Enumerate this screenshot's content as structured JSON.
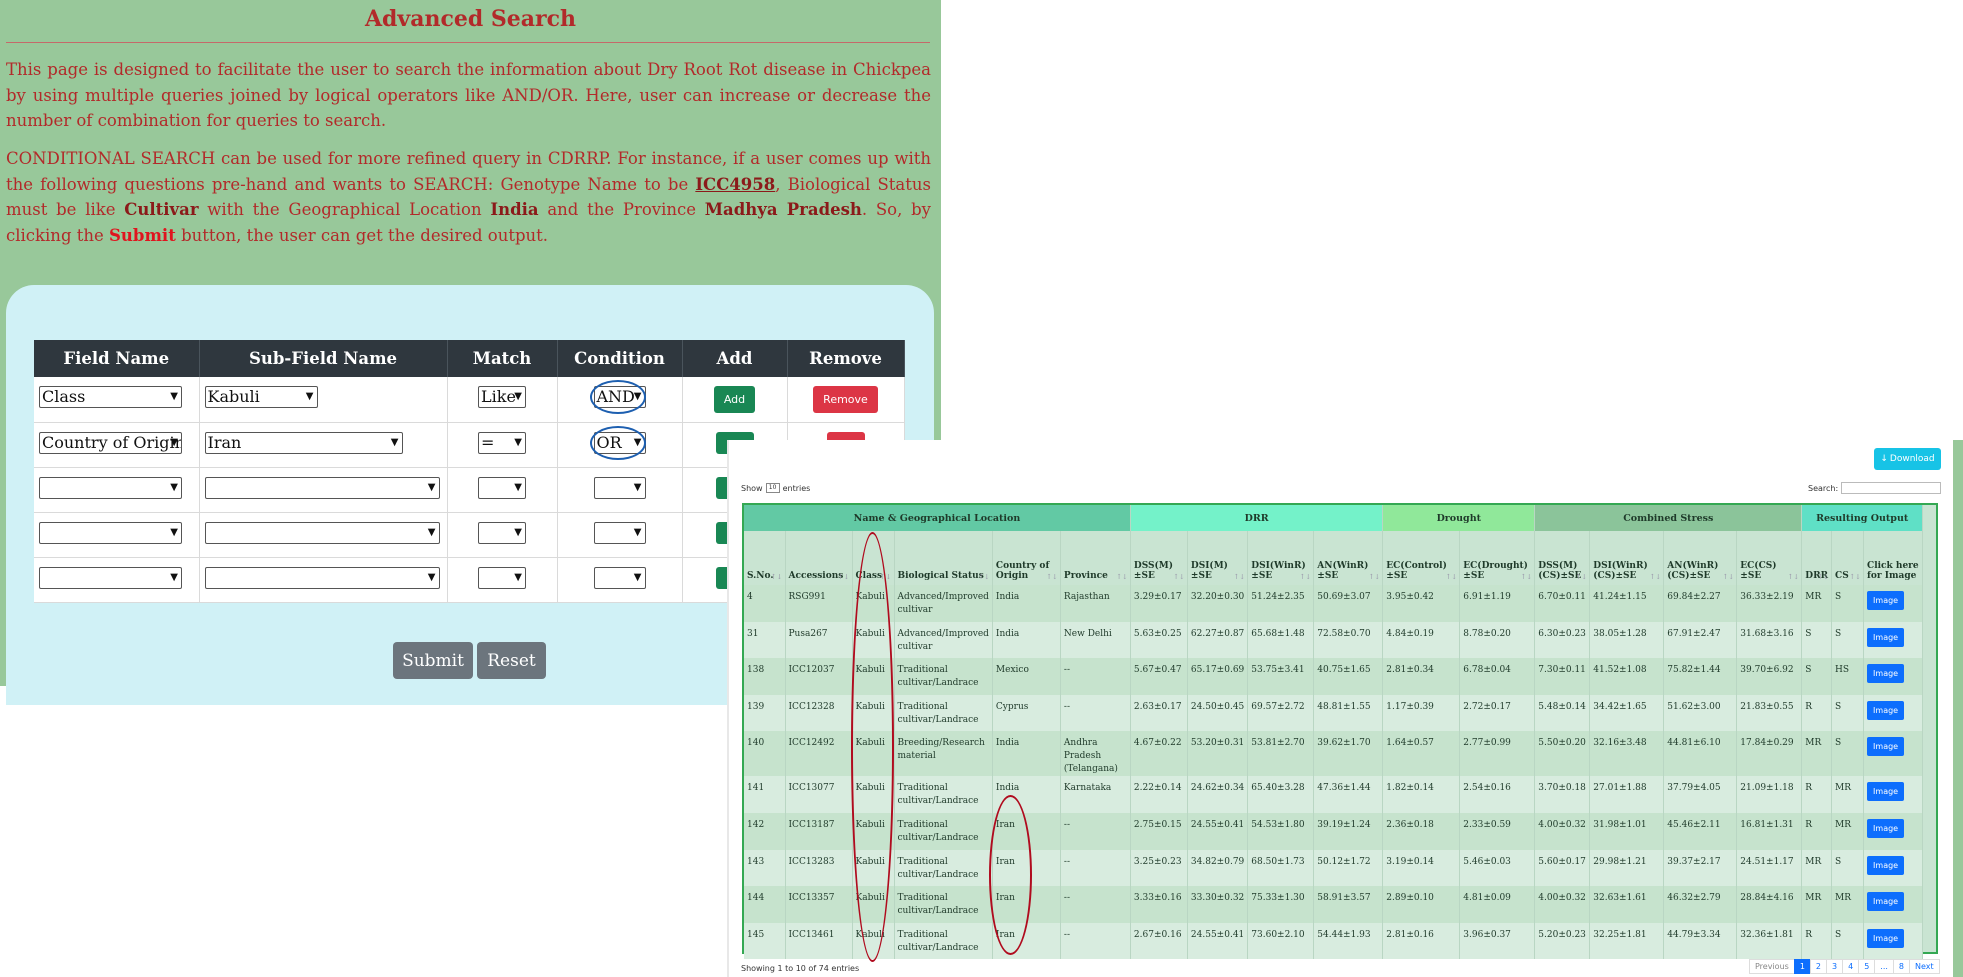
{
  "title": "Advanced Search",
  "intro1": "This page is designed to facilitate the user to search the information about Dry Root Rot disease in Chickpea by using multiple queries joined by logical operators like AND/OR. Here, user can increase or decrease the number of combination for queries to search.",
  "intro2": {
    "p1": "CONDITIONAL SEARCH can be used for more refined query in CDRRP. For instance, if a user comes up with the following questions pre-hand and wants to SEARCH: Genotype Name to be ",
    "b1": "ICC4958",
    "p2": ", Biological Status must be like ",
    "b2": "Cultivar",
    "p3": " with the Geographical Location ",
    "b3": "India",
    "p4": " and the Province ",
    "b4": "Madhya Pradesh",
    "p5": ". So, by clicking the ",
    "b5": "Submit",
    "p6": " button, the user can get the desired output."
  },
  "query_table": {
    "headers": [
      "Field Name",
      "Sub-Field Name",
      "Match",
      "Condition",
      "Add",
      "Remove"
    ],
    "rows": [
      {
        "field": "Class",
        "subfield": "Kabuli",
        "match": "Like",
        "condition": "AND"
      },
      {
        "field": "Country of Origin",
        "subfield": "Iran",
        "match": "=",
        "condition": "OR"
      },
      {
        "field": "",
        "subfield": "",
        "match": "",
        "condition": ""
      },
      {
        "field": "",
        "subfield": "",
        "match": "",
        "condition": ""
      },
      {
        "field": "",
        "subfield": "",
        "match": "",
        "condition": ""
      }
    ],
    "add_label": "Add",
    "remove_label": "Remove"
  },
  "submit_label": "Submit",
  "reset_label": "Reset",
  "results": {
    "download_label": "Download",
    "show_label": "Show",
    "show_value": "10",
    "entries_label": "entries",
    "search_label": "Search:",
    "groups": [
      {
        "label": "Name & Geographical Location"
      },
      {
        "label": "DRR"
      },
      {
        "label": "Drought"
      },
      {
        "label": "Combined Stress"
      },
      {
        "label": "Resulting Output"
      }
    ],
    "columns": [
      "S.No.",
      "Accessions",
      "Class",
      "Biological Status",
      "Country of Origin",
      "Province",
      "DSS(M) ±SE",
      "DSI(M) ±SE",
      "DSI(WinR) ±SE",
      "AN(WinR) ±SE",
      "EC(Control) ±SE",
      "EC(Drought) ±SE",
      "DSS(M) (CS)±SE",
      "DSI(WinR) (CS)±SE",
      "AN(WinR) (CS)±SE",
      "EC(CS) ±SE",
      "DRR",
      "CS",
      "Click here for Image"
    ],
    "rows": [
      [
        "4",
        "RSG991",
        "Kabuli",
        "Advanced/Improved cultivar",
        "India",
        "Rajasthan",
        "3.29±0.17",
        "32.20±0.30",
        "51.24±2.35",
        "50.69±3.07",
        "3.95±0.42",
        "6.91±1.19",
        "6.70±0.11",
        "41.24±1.15",
        "69.84±2.27",
        "36.33±2.19",
        "MR",
        "S"
      ],
      [
        "31",
        "Pusa267",
        "Kabuli",
        "Advanced/Improved cultivar",
        "India",
        "New Delhi",
        "5.63±0.25",
        "62.27±0.87",
        "65.68±1.48",
        "72.58±0.70",
        "4.84±0.19",
        "8.78±0.20",
        "6.30±0.23",
        "38.05±1.28",
        "67.91±2.47",
        "31.68±3.16",
        "S",
        "S"
      ],
      [
        "138",
        "ICC12037",
        "Kabuli",
        "Traditional cultivar/Landrace",
        "Mexico",
        "--",
        "5.67±0.47",
        "65.17±0.69",
        "53.75±3.41",
        "40.75±1.65",
        "2.81±0.34",
        "6.78±0.04",
        "7.30±0.11",
        "41.52±1.08",
        "75.82±1.44",
        "39.70±6.92",
        "S",
        "HS"
      ],
      [
        "139",
        "ICC12328",
        "Kabuli",
        "Traditional cultivar/Landrace",
        "Cyprus",
        "--",
        "2.63±0.17",
        "24.50±0.45",
        "69.57±2.72",
        "48.81±1.55",
        "1.17±0.39",
        "2.72±0.17",
        "5.48±0.14",
        "34.42±1.65",
        "51.62±3.00",
        "21.83±0.55",
        "R",
        "S"
      ],
      [
        "140",
        "ICC12492",
        "Kabuli",
        "Breeding/Research material",
        "India",
        "Andhra Pradesh (Telangana)",
        "4.67±0.22",
        "53.20±0.31",
        "53.81±2.70",
        "39.62±1.70",
        "1.64±0.57",
        "2.77±0.99",
        "5.50±0.20",
        "32.16±3.48",
        "44.81±6.10",
        "17.84±0.29",
        "MR",
        "S"
      ],
      [
        "141",
        "ICC13077",
        "Kabuli",
        "Traditional cultivar/Landrace",
        "India",
        "Karnataka",
        "2.22±0.14",
        "24.62±0.34",
        "65.40±3.28",
        "47.36±1.44",
        "1.82±0.14",
        "2.54±0.16",
        "3.70±0.18",
        "27.01±1.88",
        "37.79±4.05",
        "21.09±1.18",
        "R",
        "MR"
      ],
      [
        "142",
        "ICC13187",
        "Kabuli",
        "Traditional cultivar/Landrace",
        "Iran",
        "--",
        "2.75±0.15",
        "24.55±0.41",
        "54.53±1.80",
        "39.19±1.24",
        "2.36±0.18",
        "2.33±0.59",
        "4.00±0.32",
        "31.98±1.01",
        "45.46±2.11",
        "16.81±1.31",
        "R",
        "MR"
      ],
      [
        "143",
        "ICC13283",
        "Kabuli",
        "Traditional cultivar/Landrace",
        "Iran",
        "--",
        "3.25±0.23",
        "34.82±0.79",
        "68.50±1.73",
        "50.12±1.72",
        "3.19±0.14",
        "5.46±0.03",
        "5.60±0.17",
        "29.98±1.21",
        "39.37±2.17",
        "24.51±1.17",
        "MR",
        "S"
      ],
      [
        "144",
        "ICC13357",
        "Kabuli",
        "Traditional cultivar/Landrace",
        "Iran",
        "--",
        "3.33±0.16",
        "33.30±0.32",
        "75.33±1.30",
        "58.91±3.57",
        "2.89±0.10",
        "4.81±0.09",
        "4.00±0.32",
        "32.63±1.61",
        "46.32±2.79",
        "28.84±4.16",
        "MR",
        "MR"
      ],
      [
        "145",
        "ICC13461",
        "Kabuli",
        "Traditional cultivar/Landrace",
        "Iran",
        "--",
        "2.67±0.16",
        "24.55±0.41",
        "73.60±2.10",
        "54.44±1.93",
        "2.81±0.16",
        "3.96±0.37",
        "5.20±0.23",
        "32.25±1.81",
        "44.79±3.34",
        "32.36±1.81",
        "R",
        "S"
      ]
    ],
    "image_label": "Image",
    "showing_text": "Showing 1 to 10 of 74 entries",
    "pagination": [
      "Previous",
      "1",
      "2",
      "3",
      "4",
      "5",
      "...",
      "8",
      "Next"
    ]
  },
  "colors": {
    "title": "#b22a2a",
    "page_bg": "#98c89a",
    "card_bg": "#d0f1f6",
    "annotation": "#b00b1e",
    "condition_ring": "#1d5fb0"
  },
  "icons": [
    "chevron-down-icon",
    "download-icon",
    "sort-icon"
  ]
}
